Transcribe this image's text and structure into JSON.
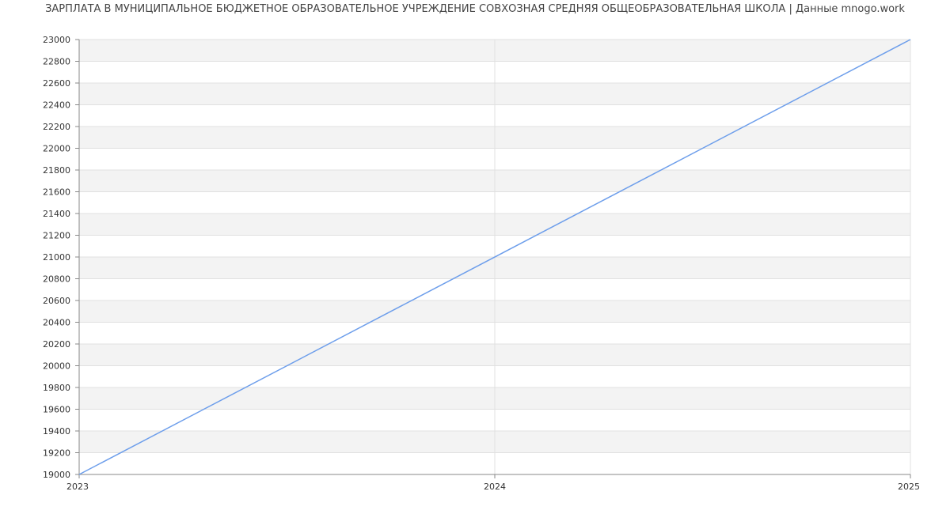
{
  "chart_data": {
    "type": "line",
    "title": "ЗАРПЛАТА В МУНИЦИПАЛЬНОЕ БЮДЖЕТНОЕ ОБРАЗОВАТЕЛЬНОЕ УЧРЕЖДЕНИЕ СОВХОЗНАЯ СРЕДНЯЯ ОБЩЕОБРАЗОВАТЕЛЬНАЯ ШКОЛА | Данные mnogo.work",
    "xlabel": "",
    "ylabel": "",
    "x": [
      2023,
      2025
    ],
    "series": [
      {
        "values": [
          19000,
          23000
        ]
      }
    ],
    "xticks": [
      "2023",
      "2024",
      "2025"
    ],
    "yticks": [
      19000,
      19200,
      19400,
      19600,
      19800,
      20000,
      20200,
      20400,
      20600,
      20800,
      21000,
      21200,
      21400,
      21600,
      21800,
      22000,
      22200,
      22400,
      22600,
      22800,
      23000
    ],
    "xlim": [
      2023,
      2025
    ],
    "ylim": [
      19000,
      23000
    ],
    "grid": true,
    "line_color": "#6d9eeb",
    "band_color": "#f3f3f3",
    "grid_color": "#e0e0e0",
    "axis_color": "#888888"
  }
}
